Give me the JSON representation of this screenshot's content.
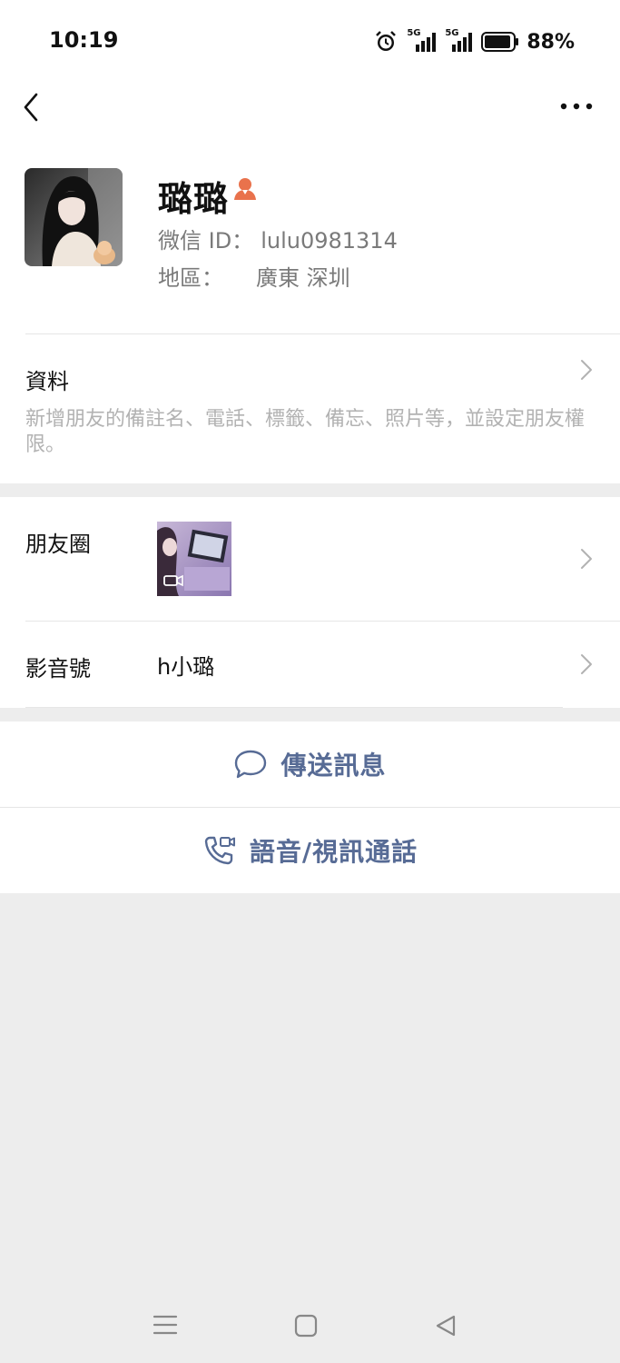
{
  "status_bar": {
    "time": "10:19",
    "network_1": "5G",
    "network_2": "5G",
    "battery": "88%"
  },
  "profile": {
    "name": "璐璐",
    "wechat_id_label": "微信 ID：",
    "wechat_id": "lulu0981314",
    "region_label": "地區：",
    "region": "廣東  深圳"
  },
  "info": {
    "title": "資料",
    "description": "新增朋友的備註名、電話、標籤、備忘、照片等，並設定朋友權限。"
  },
  "moments": {
    "label": "朋友圈"
  },
  "channels": {
    "label": "影音號",
    "value": "h小璐"
  },
  "actions": {
    "send_message": "傳送訊息",
    "call": "語音/視訊通話"
  },
  "colors": {
    "accent": "#576b95",
    "badge": "#e9724c",
    "background": "#ededed"
  },
  "icons": {
    "back": "back-chevron-icon",
    "more": "more-dots-icon",
    "badge": "contact-badge-icon",
    "message": "chat-bubble-icon",
    "call": "phone-video-icon"
  }
}
